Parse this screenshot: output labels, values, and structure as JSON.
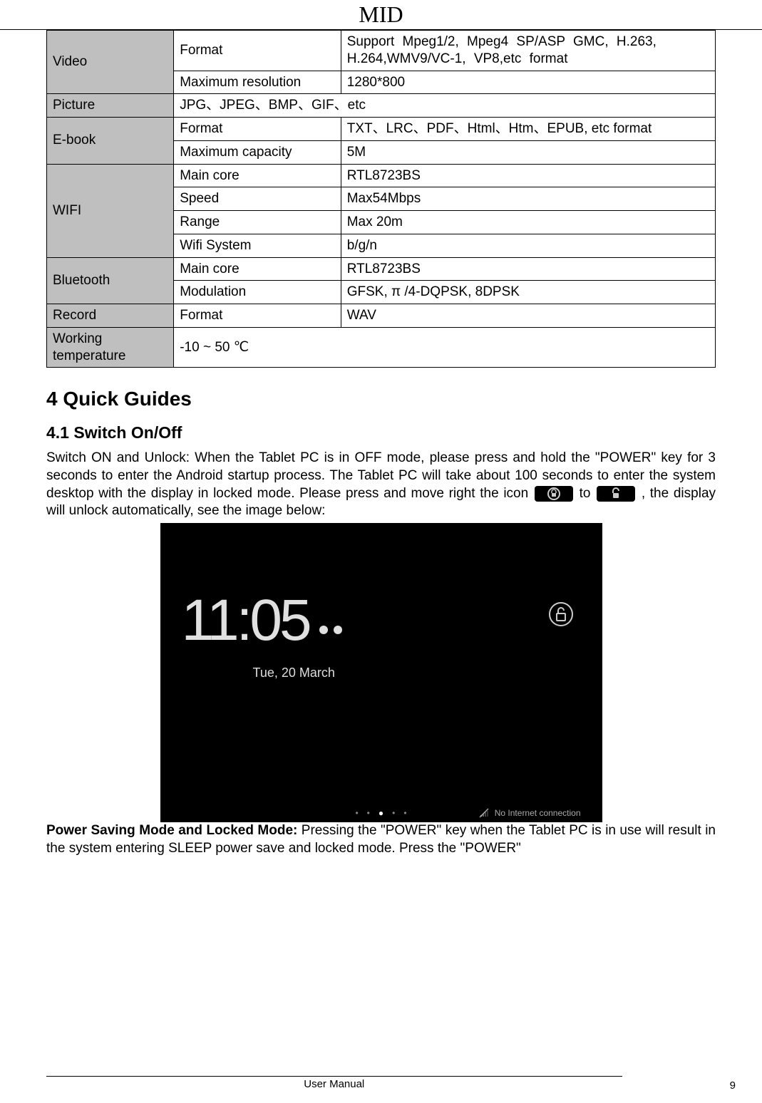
{
  "header": {
    "title": "MID"
  },
  "table": {
    "rows": [
      {
        "cat": "Video",
        "sub": "Format",
        "val": "Support Mpeg1/2, Mpeg4 SP/ASP GMC, H.263, H.264,WMV9/VC-1, VP8,etc format"
      },
      {
        "cat": "",
        "sub": "Maximum resolution",
        "val": "1280*800"
      },
      {
        "cat": "Picture",
        "sub": "",
        "val": "JPG、JPEG、BMP、GIF、etc"
      },
      {
        "cat": "E-book",
        "sub": "Format",
        "val": "TXT、LRC、PDF、Html、Htm、EPUB, etc format"
      },
      {
        "cat": "",
        "sub": "Maximum capacity",
        "val": "5M"
      },
      {
        "cat": "WIFI",
        "sub": "Main core",
        "val": "RTL8723BS"
      },
      {
        "cat": "",
        "sub": "Speed",
        "val": "Max54Mbps"
      },
      {
        "cat": "",
        "sub": "Range",
        "val": "Max 20m"
      },
      {
        "cat": "",
        "sub": "Wifi System",
        "val": "b/g/n"
      },
      {
        "cat": "Bluetooth",
        "sub": "Main core",
        "val": "RTL8723BS"
      },
      {
        "cat": "",
        "sub": "Modulation",
        "val": "GFSK, π /4-DQPSK, 8DPSK"
      },
      {
        "cat": "Record",
        "sub": "Format",
        "val": "WAV"
      },
      {
        "cat": "Working temperature",
        "sub": "",
        "val": "-10   ~ 50 ℃"
      }
    ]
  },
  "section": {
    "h2": "4 Quick Guides",
    "h3": "4.1 Switch On/Off",
    "p1a": "Switch ON and Unlock: When the Tablet PC is in OFF mode, please press and hold the \"POWER\" key for 3 seconds to enter the Android startup process. The Tablet PC will take about 100 seconds to enter the system desktop with the display in locked mode. Please press and move right the icon",
    "p1b": " to",
    "p1c": ", the display will unlock automatically, see the image below:",
    "p2a": "Power Saving Mode and Locked Mode: ",
    "p2b": "Pressing the \"POWER\" key when the Tablet PC is in use will result in the system entering SLEEP power save and locked mode. Press the \"POWER\""
  },
  "lockscreen": {
    "time": "11:05",
    "date": "Tue, 20 March",
    "status": "No Internet connection"
  },
  "footer": {
    "label": "User Manual",
    "page": "9"
  }
}
